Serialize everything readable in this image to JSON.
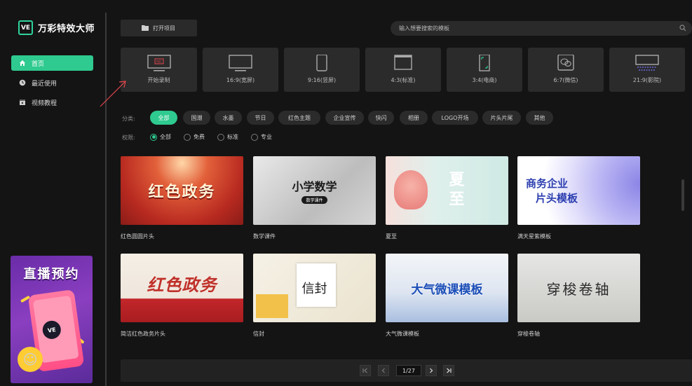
{
  "app": {
    "logo_mark": "VE",
    "title": "万彩特效大师"
  },
  "sidebar": {
    "items": [
      {
        "label": "首页",
        "icon": "home-icon",
        "active": true
      },
      {
        "label": "最近使用",
        "icon": "clock-icon",
        "active": false
      },
      {
        "label": "视频教程",
        "icon": "video-tutorial-icon",
        "active": false
      }
    ],
    "promo": {
      "title": "直播预约",
      "badge": "VE"
    }
  },
  "toolbar": {
    "open_project_label": "打开项目",
    "search_placeholder": "输入想要搜索的模板"
  },
  "ratios": [
    {
      "label": "开始录制",
      "icon": "record-screen-icon",
      "rec_text": "REC"
    },
    {
      "label": "16:9(宽屏)",
      "icon": "widescreen-icon"
    },
    {
      "label": "9:16(竖屏)",
      "icon": "portrait-screen-icon"
    },
    {
      "label": "4:3(标准)",
      "icon": "standard-screen-icon"
    },
    {
      "label": "3:4(电商)",
      "icon": "ecommerce-screen-icon"
    },
    {
      "label": "6:7(微信)",
      "icon": "wechat-icon"
    },
    {
      "label": "21:9(影院)",
      "icon": "cinema-screen-icon"
    }
  ],
  "filters": {
    "category_label": "分类:",
    "categories": [
      "全部",
      "国潮",
      "水墨",
      "节日",
      "红色主题",
      "企业宣传",
      "快闪",
      "相册",
      "LOGO开场",
      "片头片尾",
      "其他"
    ],
    "active_category": "全部",
    "permission_label": "权限:",
    "permissions": [
      "全部",
      "免费",
      "标准",
      "专业"
    ],
    "active_permission": "全部"
  },
  "templates": [
    {
      "title": "红色圆圆片头",
      "thumb_text": "红色政务"
    },
    {
      "title": "数学课件",
      "thumb_text": "小学数学",
      "thumb_sub": "数学课件"
    },
    {
      "title": "夏至",
      "thumb_text": "夏至"
    },
    {
      "title": "满天星紫模板",
      "thumb_text": "商务企业",
      "thumb_text2": "片头模板"
    },
    {
      "title": "简洁红色政务片头",
      "thumb_text": "红色政务"
    },
    {
      "title": "信封",
      "thumb_text": "信封"
    },
    {
      "title": "大气微课模板",
      "thumb_text": "大气微课模板"
    },
    {
      "title": "穿梭卷轴",
      "thumb_text": "穿梭卷轴"
    }
  ],
  "pagination": {
    "current": "1/27"
  },
  "colors": {
    "accent": "#2fca8f",
    "background": "#141414",
    "tile": "#2b2b2b"
  }
}
